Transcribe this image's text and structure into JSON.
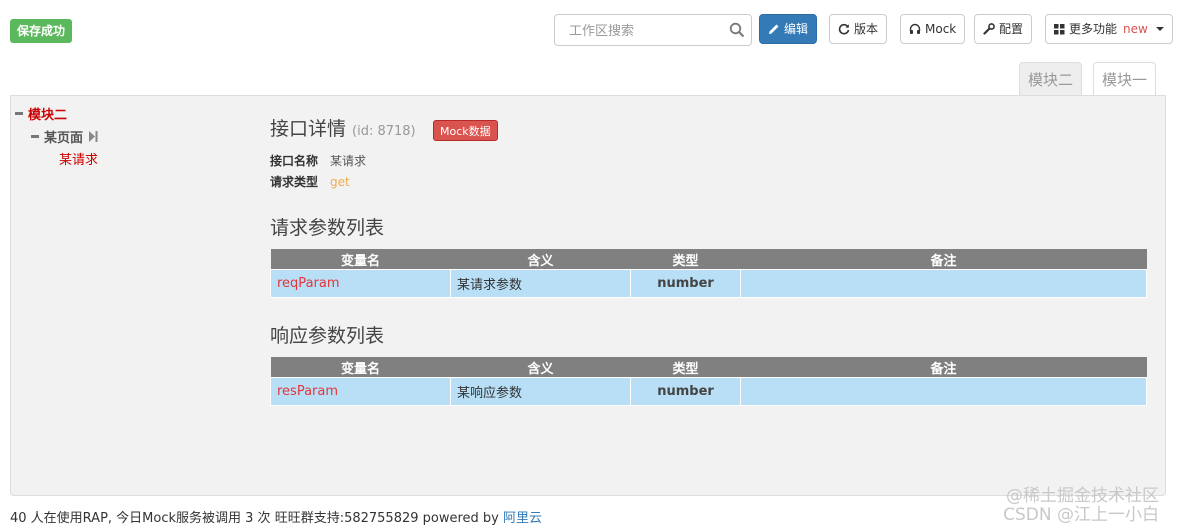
{
  "header": {
    "save_badge": "保存成功",
    "search_placeholder": "工作区搜索",
    "buttons": {
      "edit": "编辑",
      "version": "版本",
      "mock": "Mock",
      "config": "配置",
      "more": "更多功能",
      "more_tag": "new"
    }
  },
  "module_tabs": [
    "模块二",
    "模块一"
  ],
  "tree": {
    "module": "模块二",
    "page": "某页面",
    "request": "某请求"
  },
  "detail": {
    "title": "接口详情",
    "id_text": "(id: 8718)",
    "mock_button": "Mock数据",
    "name_label": "接口名称",
    "name_value": "某请求",
    "type_label": "请求类型",
    "type_value": "get"
  },
  "request_params": {
    "title": "请求参数列表",
    "headers": [
      "变量名",
      "含义",
      "类型",
      "备注"
    ],
    "rows": [
      {
        "name": "reqParam",
        "meaning": "某请求参数",
        "type": "number",
        "note": ""
      }
    ]
  },
  "response_params": {
    "title": "响应参数列表",
    "headers": [
      "变量名",
      "含义",
      "类型",
      "备注"
    ],
    "rows": [
      {
        "name": "resParam",
        "meaning": "某响应参数",
        "type": "number",
        "note": ""
      }
    ]
  },
  "footer": {
    "text": "40 人在使用RAP, 今日Mock服务被调用 3 次  旺旺群支持:582755829  powered by ",
    "link": "阿里云"
  },
  "watermark": {
    "line1": "@稀土掘金技术社区",
    "line2": "CSDN @江上一小白"
  }
}
